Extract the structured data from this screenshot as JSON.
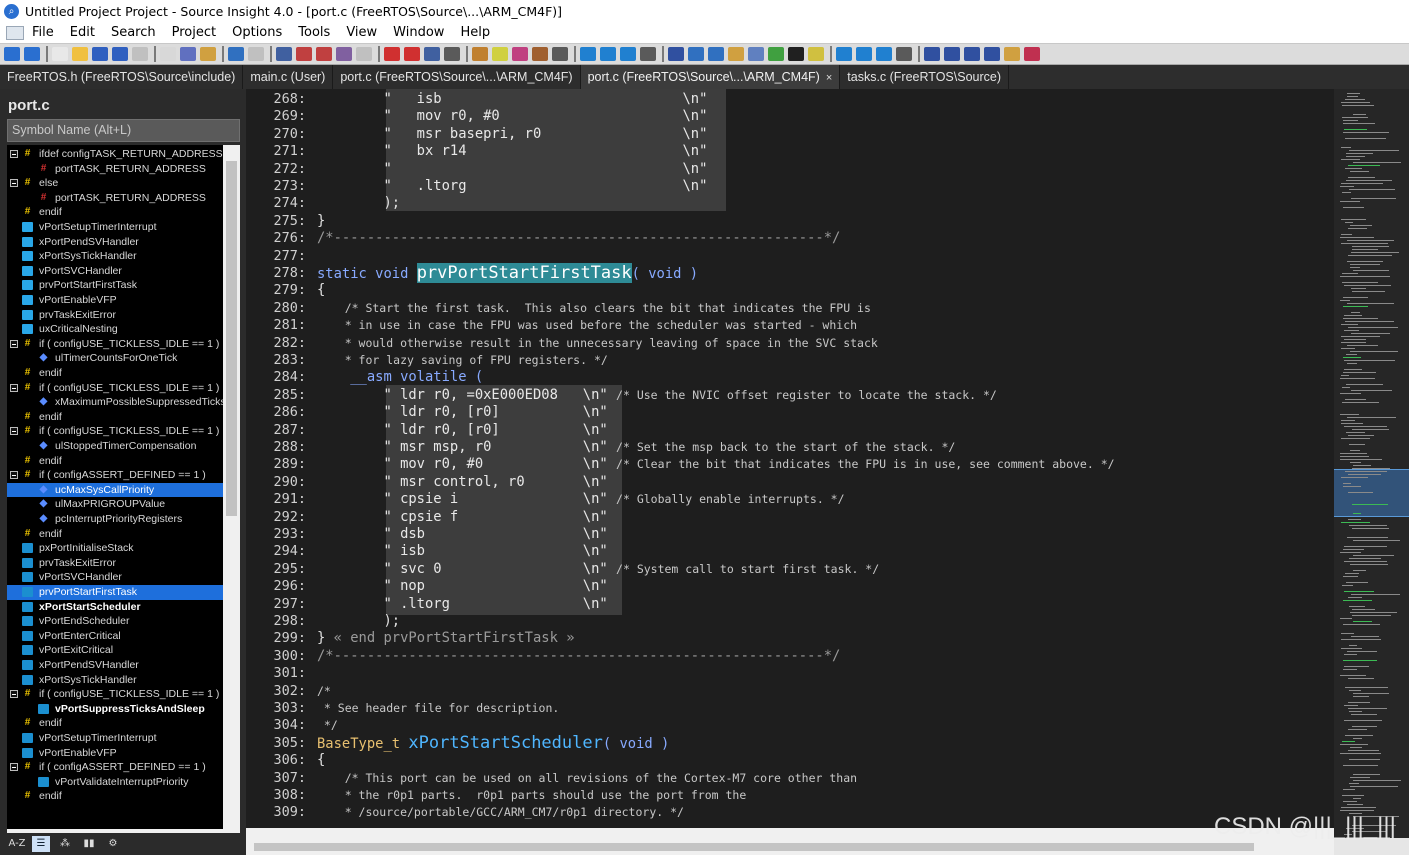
{
  "window": {
    "title": "Untitled Project Project - Source Insight 4.0 - [port.c (FreeRTOS\\Source\\...\\ARM_CM4F)]"
  },
  "menu": [
    "File",
    "Edit",
    "Search",
    "Project",
    "Options",
    "Tools",
    "View",
    "Window",
    "Help"
  ],
  "tabs": [
    {
      "label": "FreeRTOS.h (FreeRTOS\\Source\\include)",
      "active": false
    },
    {
      "label": "main.c (User)",
      "active": false
    },
    {
      "label": "port.c (FreeRTOS\\Source\\...\\ARM_CM4F)",
      "active": false
    },
    {
      "label": "port.c (FreeRTOS\\Source\\...\\ARM_CM4F)",
      "active": true,
      "close": "×"
    },
    {
      "label": "tasks.c (FreeRTOS\\Source)",
      "active": false
    }
  ],
  "sidebar": {
    "title": "port.c",
    "search_placeholder": "Symbol Name (Alt+L)",
    "footer": [
      "A-Z",
      "list-icon",
      "symbols-icon",
      "book-icon",
      "gear-icon"
    ],
    "items": [
      {
        "label": "ifdef configTASK_RETURN_ADDRESS",
        "icon": "hash",
        "indent": 0,
        "toggle": true
      },
      {
        "label": "portTASK_RETURN_ADDRESS",
        "icon": "hash-red",
        "indent": 1
      },
      {
        "label": "else",
        "icon": "hash",
        "indent": 0,
        "toggle": true
      },
      {
        "label": "portTASK_RETURN_ADDRESS",
        "icon": "hash-red",
        "indent": 1
      },
      {
        "label": "endif",
        "icon": "hash",
        "indent": 0
      },
      {
        "label": "vPortSetupTimerInterrupt",
        "icon": "func",
        "indent": 0
      },
      {
        "label": "xPortPendSVHandler",
        "icon": "func",
        "indent": 0
      },
      {
        "label": "xPortSysTickHandler",
        "icon": "func",
        "indent": 0
      },
      {
        "label": "vPortSVCHandler",
        "icon": "func",
        "indent": 0
      },
      {
        "label": "prvPortStartFirstTask",
        "icon": "func",
        "indent": 0
      },
      {
        "label": "vPortEnableVFP",
        "icon": "func",
        "indent": 0
      },
      {
        "label": "prvTaskExitError",
        "icon": "func",
        "indent": 0
      },
      {
        "label": "uxCriticalNesting",
        "icon": "func",
        "indent": 0
      },
      {
        "label": "if ( configUSE_TICKLESS_IDLE == 1 )",
        "icon": "hash",
        "indent": 0,
        "toggle": true
      },
      {
        "label": "ulTimerCountsForOneTick",
        "icon": "var",
        "indent": 1
      },
      {
        "label": "endif",
        "icon": "hash",
        "indent": 0
      },
      {
        "label": "if ( configUSE_TICKLESS_IDLE == 1 )",
        "icon": "hash",
        "indent": 0,
        "toggle": true
      },
      {
        "label": "xMaximumPossibleSuppressedTicks",
        "icon": "var",
        "indent": 1
      },
      {
        "label": "endif",
        "icon": "hash",
        "indent": 0
      },
      {
        "label": "if ( configUSE_TICKLESS_IDLE == 1 )",
        "icon": "hash",
        "indent": 0,
        "toggle": true
      },
      {
        "label": "ulStoppedTimerCompensation",
        "icon": "var",
        "indent": 1
      },
      {
        "label": "endif",
        "icon": "hash",
        "indent": 0
      },
      {
        "label": "if ( configASSERT_DEFINED == 1 )",
        "icon": "hash",
        "indent": 0,
        "toggle": true
      },
      {
        "label": "ucMaxSysCallPriority",
        "icon": "var",
        "indent": 1,
        "selected": true
      },
      {
        "label": "ulMaxPRIGROUPValue",
        "icon": "var",
        "indent": 1
      },
      {
        "label": "pcInterruptPriorityRegisters",
        "icon": "var",
        "indent": 1
      },
      {
        "label": "endif",
        "icon": "hash",
        "indent": 0
      },
      {
        "label": "pxPortInitialiseStack",
        "icon": "func-dark",
        "indent": 0
      },
      {
        "label": "prvTaskExitError",
        "icon": "func-dark",
        "indent": 0
      },
      {
        "label": "vPortSVCHandler",
        "icon": "func-dark",
        "indent": 0
      },
      {
        "label": "prvPortStartFirstTask",
        "icon": "func-dark",
        "indent": 0,
        "selected": true
      },
      {
        "label": "xPortStartScheduler",
        "icon": "func-dark",
        "indent": 0,
        "bold": true
      },
      {
        "label": "vPortEndScheduler",
        "icon": "func-dark",
        "indent": 0
      },
      {
        "label": "vPortEnterCritical",
        "icon": "func-dark",
        "indent": 0
      },
      {
        "label": "vPortExitCritical",
        "icon": "func-dark",
        "indent": 0
      },
      {
        "label": "xPortPendSVHandler",
        "icon": "func-dark",
        "indent": 0
      },
      {
        "label": "xPortSysTickHandler",
        "icon": "func-dark",
        "indent": 0
      },
      {
        "label": "if ( configUSE_TICKLESS_IDLE == 1 )",
        "icon": "hash",
        "indent": 0,
        "toggle": true
      },
      {
        "label": "vPortSuppressTicksAndSleep",
        "icon": "func-dark",
        "indent": 1,
        "bold": true
      },
      {
        "label": "endif",
        "icon": "hash",
        "indent": 0
      },
      {
        "label": "vPortSetupTimerInterrupt",
        "icon": "func-dark",
        "indent": 0
      },
      {
        "label": "vPortEnableVFP",
        "icon": "func-dark",
        "indent": 0
      },
      {
        "label": "if ( configASSERT_DEFINED == 1 )",
        "icon": "hash",
        "indent": 0,
        "toggle": true
      },
      {
        "label": "vPortValidateInterruptPriority",
        "icon": "func-dark",
        "indent": 1
      },
      {
        "label": "endif",
        "icon": "hash",
        "indent": 0
      }
    ]
  },
  "editor": {
    "lines": [
      {
        "n": "268:",
        "segs": [
          {
            "t": "        \"   isb                             \\n\"",
            "c": "asm"
          }
        ]
      },
      {
        "n": "269:",
        "segs": [
          {
            "t": "        \"   mov r0, #0                      \\n\"",
            "c": "asm"
          }
        ]
      },
      {
        "n": "270:",
        "segs": [
          {
            "t": "        \"   msr basepri, r0                 \\n\"",
            "c": "asm"
          }
        ]
      },
      {
        "n": "271:",
        "segs": [
          {
            "t": "        \"   bx r14                          \\n\"",
            "c": "asm"
          }
        ]
      },
      {
        "n": "272:",
        "segs": [
          {
            "t": "        \"                                   \\n\"",
            "c": "asm"
          }
        ]
      },
      {
        "n": "273:",
        "segs": [
          {
            "t": "        \"   .ltorg                          \\n\"",
            "c": "asm"
          }
        ]
      },
      {
        "n": "274:",
        "segs": [
          {
            "t": "        );",
            "c": "punc"
          }
        ]
      },
      {
        "n": "275:",
        "segs": [
          {
            "t": "}",
            "c": "punc"
          }
        ]
      },
      {
        "n": "276:",
        "segs": [
          {
            "t": "/*-----------------------------------------------------------*/",
            "c": "dim"
          }
        ]
      },
      {
        "n": "277:",
        "segs": []
      },
      {
        "n": "278:",
        "segs": [
          {
            "t": "static void ",
            "c": "kw"
          },
          {
            "t": "prvPortStartFirstTask",
            "c": "fnbig"
          },
          {
            "t": "( void )",
            "c": "kw"
          }
        ]
      },
      {
        "n": "279:",
        "segs": [
          {
            "t": "{",
            "c": "punc"
          }
        ]
      },
      {
        "n": "280:",
        "segs": [
          {
            "t": "    /* Start the first task.  This also clears the bit that indicates the FPU is",
            "c": "cmt"
          }
        ]
      },
      {
        "n": "281:",
        "segs": [
          {
            "t": "    * in use in case the FPU was used before the scheduler was started - which",
            "c": "cmt"
          }
        ]
      },
      {
        "n": "282:",
        "segs": [
          {
            "t": "    * would otherwise result in the unnecessary leaving of space in the SVC stack",
            "c": "cmt"
          }
        ]
      },
      {
        "n": "283:",
        "segs": [
          {
            "t": "    * for lazy saving of FPU registers. */",
            "c": "cmt"
          }
        ]
      },
      {
        "n": "284:",
        "segs": [
          {
            "t": "    __asm volatile (",
            "c": "kw"
          }
        ]
      },
      {
        "n": "285:",
        "segs": [
          {
            "t": "        \" ldr r0, =0xE000ED08   \\n\" ",
            "c": "asm"
          },
          {
            "t": "/* Use the NVIC offset register to locate the stack. */",
            "c": "cmt"
          }
        ]
      },
      {
        "n": "286:",
        "segs": [
          {
            "t": "        \" ldr r0, [r0]          \\n\"",
            "c": "asm"
          }
        ]
      },
      {
        "n": "287:",
        "segs": [
          {
            "t": "        \" ldr r0, [r0]          \\n\"",
            "c": "asm"
          }
        ]
      },
      {
        "n": "288:",
        "segs": [
          {
            "t": "        \" msr msp, r0           \\n\" ",
            "c": "asm"
          },
          {
            "t": "/* Set the msp back to the start of the stack. */",
            "c": "cmt"
          }
        ]
      },
      {
        "n": "289:",
        "segs": [
          {
            "t": "        \" mov r0, #0            \\n\" ",
            "c": "asm"
          },
          {
            "t": "/* Clear the bit that indicates the FPU is in use, see comment above. */",
            "c": "cmt"
          }
        ]
      },
      {
        "n": "290:",
        "segs": [
          {
            "t": "        \" msr control, r0       \\n\"",
            "c": "asm"
          }
        ]
      },
      {
        "n": "291:",
        "segs": [
          {
            "t": "        \" cpsie i               \\n\" ",
            "c": "asm"
          },
          {
            "t": "/* Globally enable interrupts. */",
            "c": "cmt"
          }
        ]
      },
      {
        "n": "292:",
        "segs": [
          {
            "t": "        \" cpsie f               \\n\"",
            "c": "asm"
          }
        ]
      },
      {
        "n": "293:",
        "segs": [
          {
            "t": "        \" dsb                   \\n\"",
            "c": "asm"
          }
        ]
      },
      {
        "n": "294:",
        "segs": [
          {
            "t": "        \" isb                   \\n\"",
            "c": "asm"
          }
        ]
      },
      {
        "n": "295:",
        "segs": [
          {
            "t": "        \" svc 0                 \\n\" ",
            "c": "asm"
          },
          {
            "t": "/* System call to start first task. */",
            "c": "cmt"
          }
        ]
      },
      {
        "n": "296:",
        "segs": [
          {
            "t": "        \" nop                   \\n\"",
            "c": "asm"
          }
        ]
      },
      {
        "n": "297:",
        "segs": [
          {
            "t": "        \" .ltorg                \\n\"",
            "c": "asm"
          }
        ]
      },
      {
        "n": "298:",
        "segs": [
          {
            "t": "        );",
            "c": "punc"
          }
        ]
      },
      {
        "n": "299:",
        "segs": [
          {
            "t": "} ",
            "c": "punc"
          },
          {
            "t": "« end prvPortStartFirstTask »",
            "c": "dim"
          }
        ]
      },
      {
        "n": "300:",
        "segs": [
          {
            "t": "/*-----------------------------------------------------------*/",
            "c": "dim"
          }
        ]
      },
      {
        "n": "301:",
        "segs": []
      },
      {
        "n": "302:",
        "segs": [
          {
            "t": "/*",
            "c": "cmt"
          }
        ]
      },
      {
        "n": "303:",
        "segs": [
          {
            "t": " * See header file for description.",
            "c": "cmt"
          }
        ]
      },
      {
        "n": "304:",
        "segs": [
          {
            "t": " */",
            "c": "cmt"
          }
        ]
      },
      {
        "n": "305:",
        "segs": [
          {
            "t": "BaseType_t ",
            "c": "type"
          },
          {
            "t": "xPortStartScheduler",
            "c": "fnbig2"
          },
          {
            "t": "( void )",
            "c": "kw"
          }
        ]
      },
      {
        "n": "306:",
        "segs": [
          {
            "t": "{",
            "c": "punc"
          }
        ]
      },
      {
        "n": "307:",
        "segs": [
          {
            "t": "    /* This port can be used on all revisions of the Cortex-M7 core other than",
            "c": "cmt"
          }
        ]
      },
      {
        "n": "308:",
        "segs": [
          {
            "t": "    * the r0p1 parts.  r0p1 parts should use the port from the",
            "c": "cmt"
          }
        ]
      },
      {
        "n": "309:",
        "segs": [
          {
            "t": "    * /source/portable/GCC/ARM_CM7/r0p1 directory. */",
            "c": "cmt"
          }
        ]
      }
    ]
  },
  "watermark": "CSDN @|||_|||_|||"
}
